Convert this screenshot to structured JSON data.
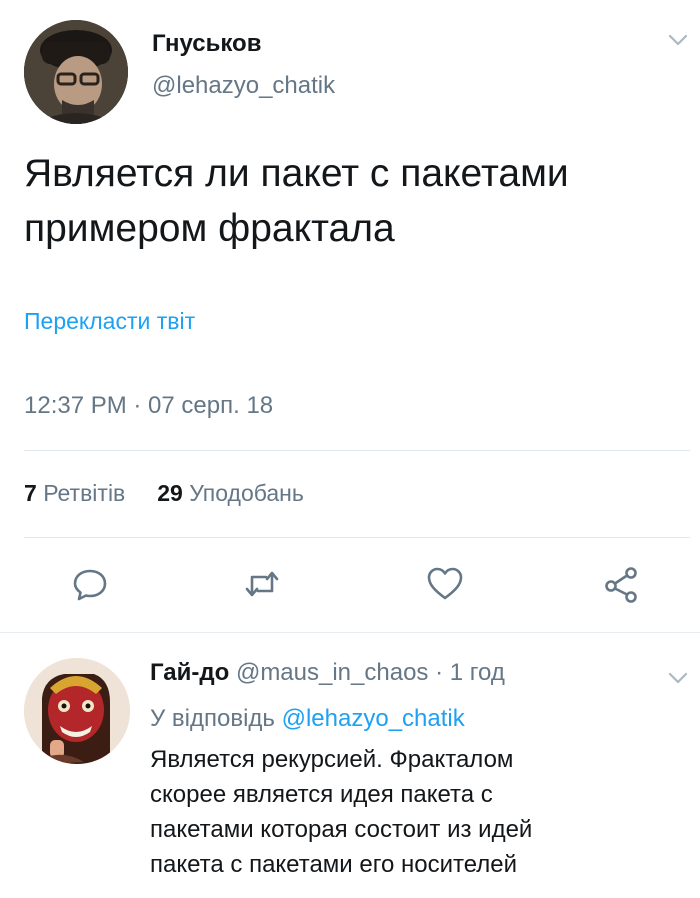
{
  "tweet": {
    "author_name": "Гнуськов",
    "author_handle": "@lehazyo_chatik",
    "text_lines": [
      "Является ли пакет с пакетами",
      "примером фрактала"
    ],
    "translate_label": "Перекласти твіт",
    "timestamp": "12:37 PM · 07 серп. 18",
    "retweets_count": "7",
    "retweets_label": "Ретвітів",
    "likes_count": "29",
    "likes_label": "Уподобань"
  },
  "actions": [
    {
      "icon": "reply-icon"
    },
    {
      "icon": "retweet-icon"
    },
    {
      "icon": "like-heart-icon"
    },
    {
      "icon": "share-icon"
    }
  ],
  "reply": {
    "author_name": "Гай-до",
    "author_handle": "@maus_in_chaos",
    "time": "· 1 год",
    "in_reply_prefix": "У відповідь",
    "in_reply_handle": "@lehazyo_chatik",
    "text_lines": [
      "Является рекурсией. Фракталом",
      "скорее является идея пакета с",
      "пакетами которая состоит из идей",
      "пакета с пакетами его носителей"
    ]
  },
  "colors": {
    "accent": "#1da1f2",
    "secondary_text": "#657786",
    "primary_text": "#14171a",
    "divider": "#e1e8ed"
  }
}
